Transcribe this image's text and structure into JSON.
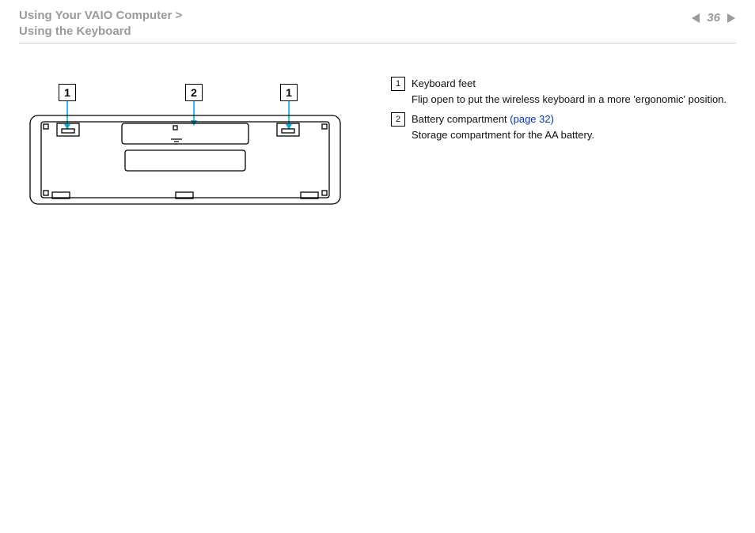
{
  "breadcrumb": {
    "line1": "Using Your VAIO Computer >",
    "line2": "Using the Keyboard"
  },
  "page_number": "36",
  "callouts": {
    "a": "1",
    "b": "2",
    "c": "1"
  },
  "items": [
    {
      "num": "1",
      "title": "Keyboard feet",
      "desc": "Flip open to put the wireless keyboard in a more 'ergonomic' position."
    },
    {
      "num": "2",
      "title": "Battery compartment ",
      "link": "(page 32)",
      "desc": "Storage compartment for the AA battery."
    }
  ]
}
